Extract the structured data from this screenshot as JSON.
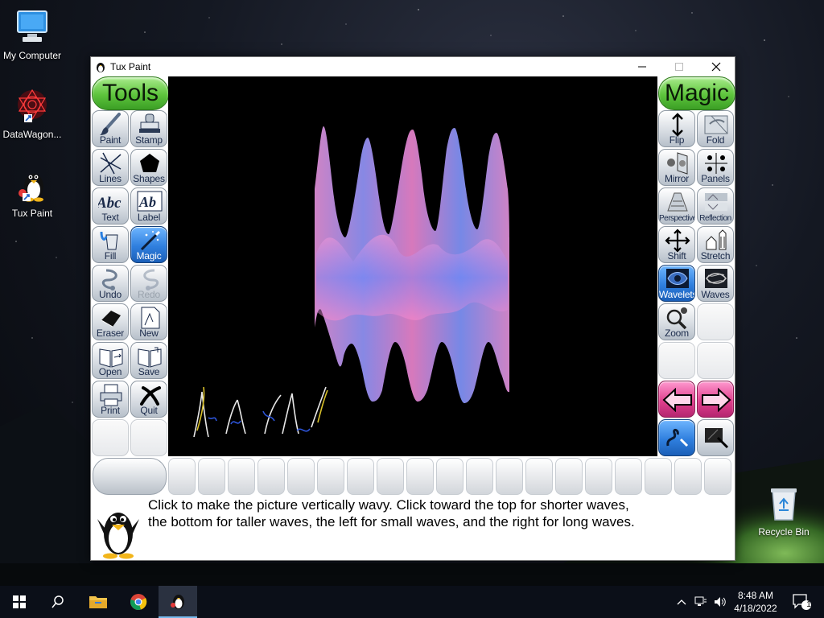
{
  "desktop": {
    "icons": [
      {
        "label": "My Computer"
      },
      {
        "label": "DataWagon..."
      },
      {
        "label": "Tux Paint"
      },
      {
        "label": "Recycle Bin"
      }
    ]
  },
  "window": {
    "title": "Tux Paint"
  },
  "tools": {
    "header": "Tools",
    "items": [
      {
        "label": "Paint"
      },
      {
        "label": "Stamp"
      },
      {
        "label": "Lines"
      },
      {
        "label": "Shapes"
      },
      {
        "label": "Text"
      },
      {
        "label": "Label"
      },
      {
        "label": "Fill"
      },
      {
        "label": "Magic"
      },
      {
        "label": "Undo"
      },
      {
        "label": "Redo"
      },
      {
        "label": "Eraser"
      },
      {
        "label": "New"
      },
      {
        "label": "Open"
      },
      {
        "label": "Save"
      },
      {
        "label": "Print"
      },
      {
        "label": "Quit"
      }
    ],
    "selected": "Magic"
  },
  "magic": {
    "header": "Magic",
    "items": [
      {
        "label": "Flip"
      },
      {
        "label": "Fold"
      },
      {
        "label": "Mirror"
      },
      {
        "label": "Panels"
      },
      {
        "label": "Perspective"
      },
      {
        "label": "Reflection"
      },
      {
        "label": "Shift"
      },
      {
        "label": "Stretch"
      },
      {
        "label": "Wavelets"
      },
      {
        "label": "Waves"
      },
      {
        "label": "Zoom"
      }
    ],
    "selected": "Wavelets"
  },
  "instructions": {
    "line1": "Click to make the picture vertically wavy. Click toward the top for shorter waves,",
    "line2": "the bottom for taller waves, the left for small waves, and the right for long waves."
  },
  "taskbar": {
    "time": "8:48 AM",
    "date": "4/18/2022",
    "notification_count": "1"
  },
  "colors": {
    "selected_blue": "#2f7fde",
    "header_green": "#5dc43c",
    "arrow_pink": "#e0408e",
    "canvas": "#000000"
  }
}
